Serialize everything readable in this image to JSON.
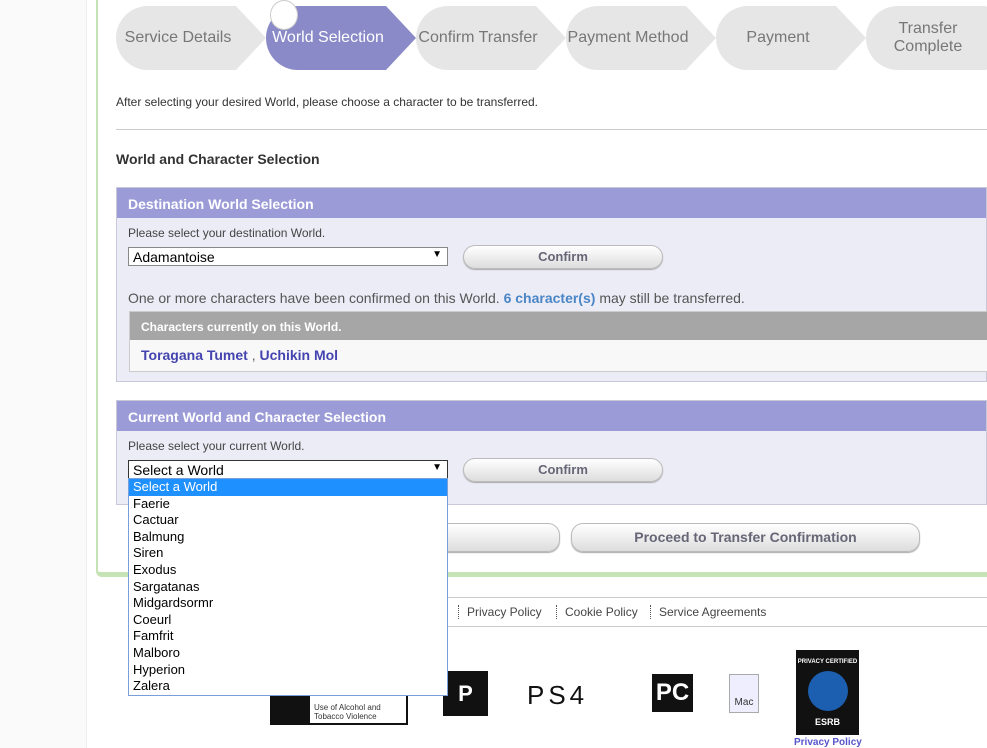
{
  "steps": [
    "Service Details",
    "World Selection",
    "Confirm Transfer",
    "Payment Method",
    "Payment",
    "Transfer Complete"
  ],
  "active_step": "World Selection",
  "intro": "After selecting your desired World, please choose a character to be transferred.",
  "section_title": "World and Character Selection",
  "destination": {
    "title": "Destination World Selection",
    "label": "Please select your destination World.",
    "selected": "Adamantoise",
    "confirm": "Confirm",
    "note_pre": "One or more characters have been confirmed on this World.",
    "note_count": "6 character(s)",
    "note_post": "may still be transferred.",
    "chars_header": "Characters currently on this World.",
    "characters": [
      "Toragana Tumet",
      "Uchikin Mol"
    ],
    "separator": ","
  },
  "current": {
    "title": "Current World and Character Selection",
    "label": "Please select your current World.",
    "selected": "Select a World",
    "confirm": "Confirm",
    "options": [
      "Select a World",
      "Faerie",
      "Cactuar",
      "Balmung",
      "Siren",
      "Exodus",
      "Sargatanas",
      "Midgardsormr",
      "Coeurl",
      "Famfrit",
      "Malboro",
      "Hyperion",
      "Zalera"
    ]
  },
  "proceed": "Proceed to Transfer Confirmation",
  "footer": {
    "links": [
      "Privacy Policy",
      "Cookie Policy",
      "Service Agreements"
    ],
    "esrb_text": "Use of Alcohol and Tobacco Violence",
    "esrb_privacy_link": "Privacy Policy",
    "logos": [
      "ESRB",
      "PS",
      "PS4",
      "PC",
      "Mac",
      "PRIVACY CERTIFIED ESRB"
    ]
  },
  "colors": {
    "panel_header": "#9b9bd8",
    "active_step": "#8a8ac8",
    "link": "#4444b0",
    "count": "#4a86c5"
  }
}
